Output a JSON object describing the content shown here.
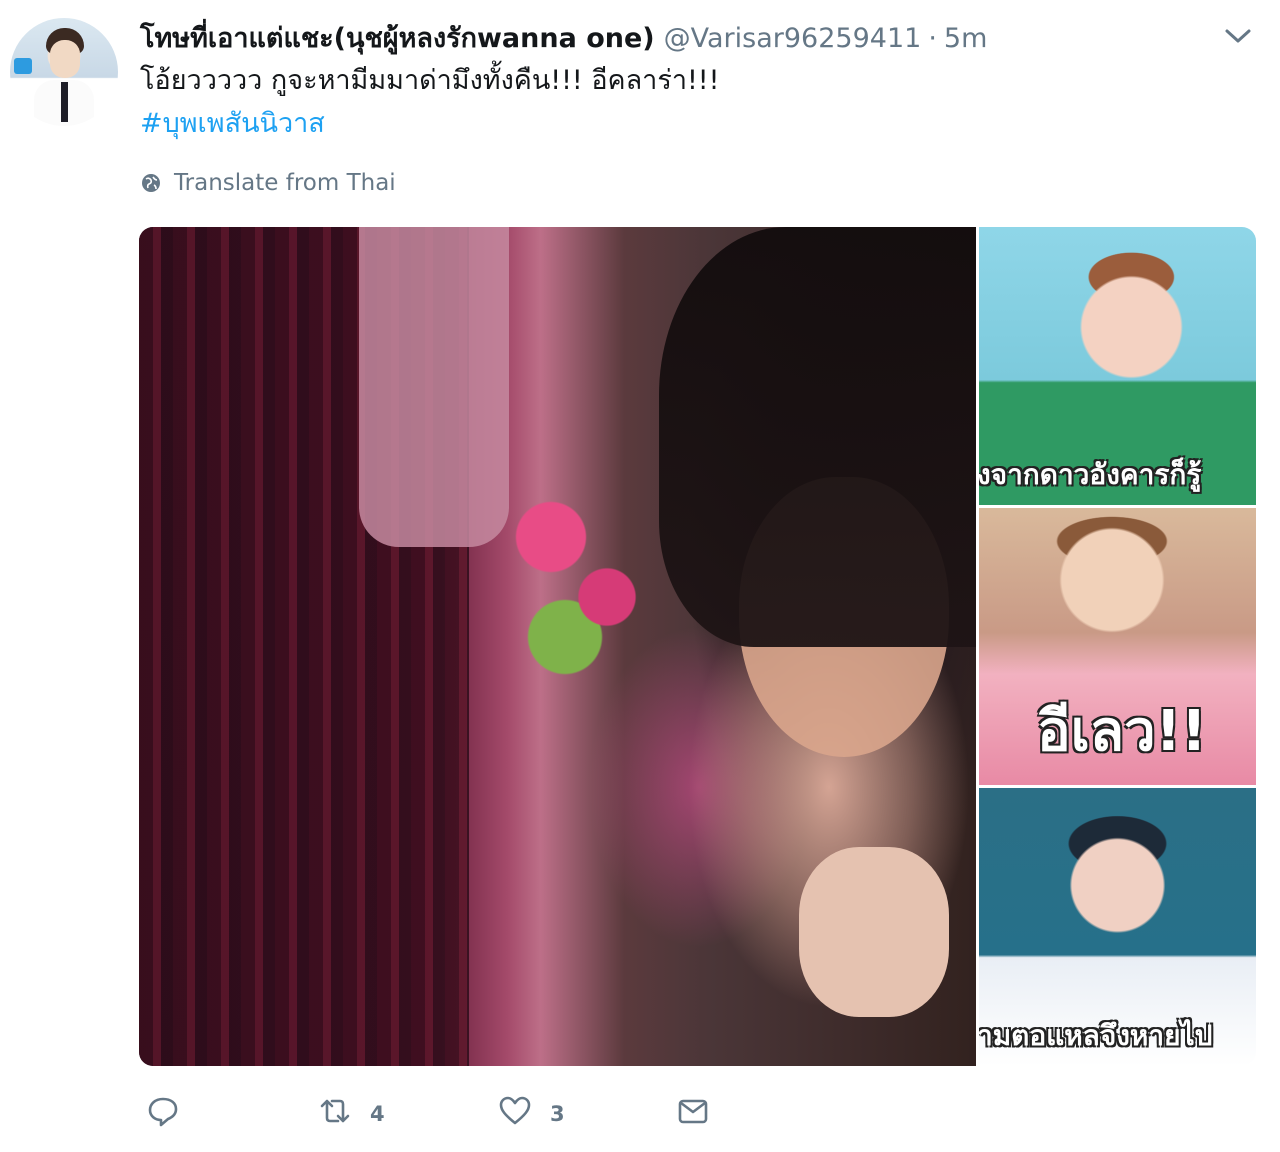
{
  "tweet": {
    "display_name": "โทษที่เอาแต่แชะ(นุชผู้หลงรักwanna one)",
    "handle": "@Varisar96259411",
    "separator": "·",
    "time": "5m",
    "text": "โอ้ยววววว กูจะหามีมมาด่ามึงทั้งคืน!!! อีคลาร่า!!!",
    "hashtag": "#บุพเพสันนิวาส",
    "translate_label": "Translate from Thai"
  },
  "media": {
    "side_captions": [
      "งจากดาวอังคารก็รู้",
      "อีเลว!!",
      "ามตอแหลจึงหายไป"
    ]
  },
  "actions": {
    "reply_count": "",
    "retweet_count": "4",
    "like_count": "3"
  },
  "colors": {
    "link": "#1da1f2",
    "secondary_text": "#657786",
    "primary_text": "#14171a"
  },
  "icons": [
    "globe-icon",
    "chevron-down-icon",
    "reply-icon",
    "retweet-icon",
    "heart-icon",
    "envelope-icon"
  ]
}
